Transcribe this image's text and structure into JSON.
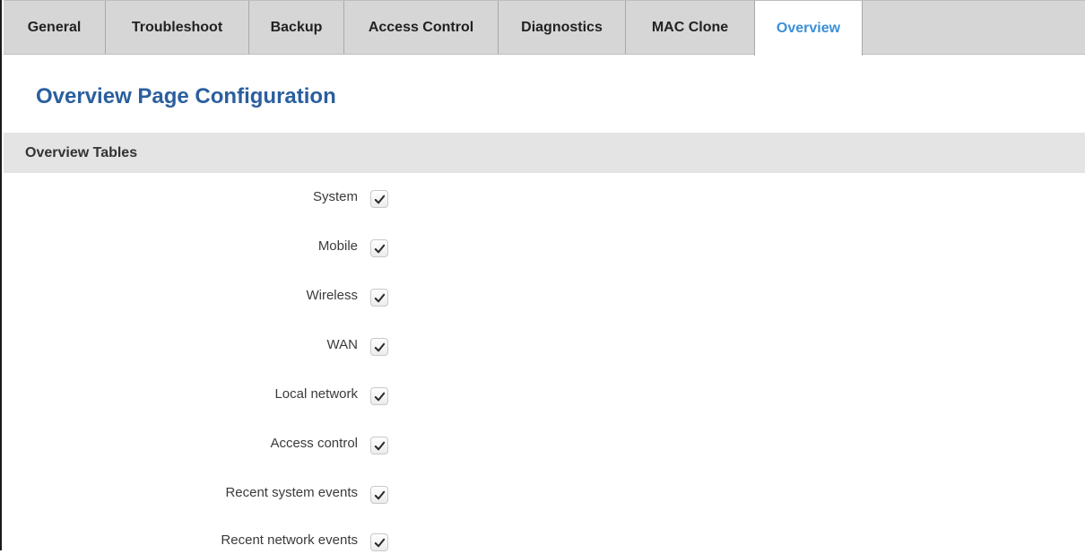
{
  "tabs": [
    {
      "label": "General",
      "active": false
    },
    {
      "label": "Troubleshoot",
      "active": false
    },
    {
      "label": "Backup",
      "active": false
    },
    {
      "label": "Access Control",
      "active": false
    },
    {
      "label": "Diagnostics",
      "active": false
    },
    {
      "label": "MAC Clone",
      "active": false
    },
    {
      "label": "Overview",
      "active": true
    }
  ],
  "page": {
    "title": "Overview Page Configuration"
  },
  "section": {
    "title": "Overview Tables"
  },
  "options": [
    {
      "label": "System",
      "checked": true
    },
    {
      "label": "Mobile",
      "checked": true
    },
    {
      "label": "Wireless",
      "checked": true
    },
    {
      "label": "WAN",
      "checked": true
    },
    {
      "label": "Local network",
      "checked": true
    },
    {
      "label": "Access control",
      "checked": true
    },
    {
      "label": "Recent system events",
      "checked": true
    },
    {
      "label": "Recent network events",
      "checked": true
    }
  ],
  "colors": {
    "active_tab": "#3b8fd8",
    "title": "#2a5f9e",
    "tabbar_bg": "#d6d6d6",
    "section_bg": "#e4e4e4"
  },
  "icons": {
    "checkbox_mark": "checkmark-icon"
  }
}
